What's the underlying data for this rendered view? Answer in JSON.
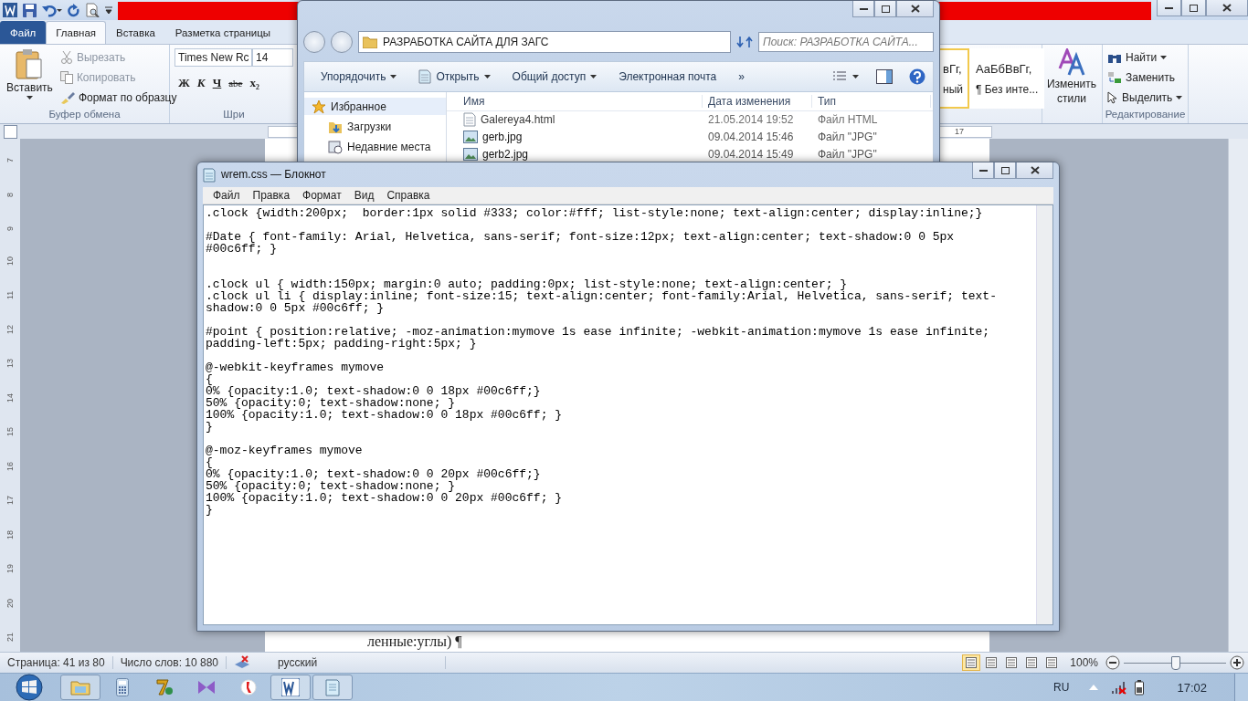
{
  "word": {
    "tabs": [
      {
        "label": "Файл",
        "kind": "file",
        "selected": false
      },
      {
        "label": "Главная",
        "kind": "tab",
        "selected": true
      },
      {
        "label": "Вставка",
        "kind": "tab",
        "selected": false
      },
      {
        "label": "Разметка страницы",
        "kind": "tab",
        "selected": false
      }
    ],
    "clipboard": {
      "paste": "Вставить",
      "cut": "Вырезать",
      "copy": "Копировать",
      "format_painter": "Формат по образцу",
      "group": "Буфер обмена"
    },
    "font": {
      "name": "Times New Rc",
      "size": "14",
      "bold": "Ж",
      "italic": "К",
      "underline": "Ч",
      "strike": "abe",
      "subscript": "x₂",
      "group": "Шри"
    },
    "styles": [
      {
        "sample": "вГг,",
        "name": "ный",
        "selected": true
      },
      {
        "sample": "АаБбВвГг,",
        "name": "¶ Без инте...",
        "selected": false
      }
    ],
    "change_styles": [
      "Изменить",
      "стили"
    ],
    "editing": {
      "find": "Найти",
      "replace": "Заменить",
      "select": "Выделить",
      "group": "Редактирование"
    },
    "top_ruler": [
      "17"
    ],
    "vertical_ruler": [
      "7",
      "8",
      "9",
      "10",
      "11",
      "12",
      "13",
      "14",
      "15",
      "16",
      "17",
      "18",
      "19",
      "20",
      "21"
    ],
    "page_text": "ленные:углы) ¶",
    "status": {
      "page": "Страница: 41 из 80",
      "words": "Число слов: 10 880",
      "language": "русский",
      "zoom": "100%"
    },
    "views": [
      {
        "selected": true
      },
      {
        "selected": false
      },
      {
        "selected": false
      },
      {
        "selected": false
      },
      {
        "selected": false
      }
    ],
    "zoom_slider": {
      "level": 0.5
    }
  },
  "explorer": {
    "address": "РАЗРАБОТКА САЙТА ДЛЯ ЗАГС",
    "search": {
      "placeholder": "Поиск: РАЗРАБОТКА САЙТА..."
    },
    "toolbar": [
      {
        "label": "Упорядочить",
        "kind": "menu"
      },
      {
        "label": "Открыть",
        "kind": "open"
      },
      {
        "label": "Общий доступ",
        "kind": "menu"
      },
      {
        "label": "Электронная почта",
        "kind": "plain"
      },
      {
        "label": "»",
        "kind": "plain"
      }
    ],
    "nav": [
      {
        "label": "Избранное",
        "kind": "star",
        "selected": true
      },
      {
        "label": "Загрузки",
        "kind": "download",
        "selected": false
      },
      {
        "label": "Недавние места",
        "kind": "recent",
        "selected": false
      }
    ],
    "columns": [
      "Имя",
      "Дата изменения",
      "Тип"
    ],
    "rows": [
      {
        "name": "Galereya4.html",
        "date": "21.05.2014 19:52",
        "type": "Файл HTML",
        "kind": "html"
      },
      {
        "name": "gerb.jpg",
        "date": "09.04.2014 15:46",
        "type": "Файл \"JPG\"",
        "kind": "image"
      },
      {
        "name": "gerb2.jpg",
        "date": "09.04.2014 15:49",
        "type": "Файл \"JPG\"",
        "kind": "image"
      }
    ]
  },
  "notepad": {
    "title": "wrem.css — Блокнот",
    "menu": [
      "Файл",
      "Правка",
      "Формат",
      "Вид",
      "Справка"
    ],
    "text": ".clock {width:200px;  border:1px solid #333; color:#fff; list-style:none; text-align:center; display:inline;}\n\n#Date { font-family: Arial, Helvetica, sans-serif; font-size:12px; text-align:center; text-shadow:0 0 5px\n#00c6ff; }\n\n\n.clock ul { width:150px; margin:0 auto; padding:0px; list-style:none; text-align:center; }\n.clock ul li { display:inline; font-size:15; text-align:center; font-family:Arial, Helvetica, sans-serif; text-\nshadow:0 0 5px #00c6ff; }\n\n#point { position:relative; -moz-animation:mymove 1s ease infinite; -webkit-animation:mymove 1s ease infinite;\npadding-left:5px; padding-right:5px; }\n\n@-webkit-keyframes mymove\n{\n0% {opacity:1.0; text-shadow:0 0 18px #00c6ff;}\n50% {opacity:0; text-shadow:none; }\n100% {opacity:1.0; text-shadow:0 0 18px #00c6ff; }\n}\n\n@-moz-keyframes mymove\n{\n0% {opacity:1.0; text-shadow:0 0 20px #00c6ff;}\n50% {opacity:0; text-shadow:none; }\n100% {opacity:1.0; text-shadow:0 0 20px #00c6ff; }\n}"
  },
  "taskbar": {
    "apps": [
      {
        "kind": "explorer",
        "open": true
      },
      {
        "kind": "calculator",
        "open": false
      },
      {
        "kind": "archiver",
        "open": false
      },
      {
        "kind": "studio",
        "open": false
      },
      {
        "kind": "browser",
        "open": false
      },
      {
        "kind": "word",
        "open": true
      },
      {
        "kind": "notepad",
        "open": true
      }
    ],
    "language": "RU",
    "time": "17:02"
  }
}
